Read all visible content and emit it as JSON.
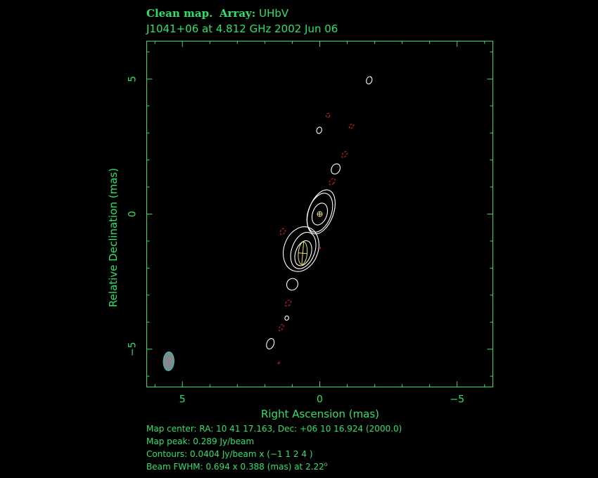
{
  "title": {
    "prefix": "Clean map.",
    "array_label": "Array:",
    "array_value": "UHbV",
    "subtitle": "J1041+06 at 4.812 GHz 2002 Jun 06"
  },
  "footer": {
    "map_center": "Map center:  RA: 10 41 17.163,  Dec: +06 10 16.924 (2000.0)",
    "map_peak": "Map peak: 0.289 Jy/beam",
    "contours": "Contours: 0.0404 Jy/beam x (−1 1 2 4 )",
    "beam_prefix": "Beam FWHM: 0.694 x 0.388 (mas) at 2.22",
    "beam_degree": "o"
  },
  "chart_data": {
    "type": "contour",
    "xlabel": "Right Ascension   (mas)",
    "ylabel": "Relative Declination   (mas)",
    "xlim": [
      6.3,
      -6.3
    ],
    "ylim": [
      -6.4,
      6.4
    ],
    "xticks": [
      5,
      0,
      -5
    ],
    "yticks": [
      5,
      0,
      -5
    ],
    "xtick_labels": [
      "5",
      "0",
      "−5"
    ],
    "ytick_labels": [
      "5",
      "0",
      "−5"
    ],
    "colors": {
      "axes": "#2ee06a",
      "positive_contour": "#ffffff",
      "negative_contour": "#d42020",
      "components": "#e8e060",
      "beam_fill": "#888888",
      "beam_edge": "#30c0c0"
    },
    "contours": [
      {
        "x": 0.0,
        "y": 0.0,
        "rx": 0.26,
        "ry": 0.42,
        "angle": 20,
        "sign": "positive",
        "level": 1
      },
      {
        "x": 0.0,
        "y": 0.05,
        "rx": 0.42,
        "ry": 0.75,
        "angle": 20,
        "sign": "positive",
        "level": 2
      },
      {
        "x": -0.05,
        "y": 0.08,
        "rx": 0.45,
        "ry": 0.85,
        "angle": 20,
        "sign": "positive",
        "level": 1
      },
      {
        "x": 0.6,
        "y": -1.45,
        "rx": 0.28,
        "ry": 0.48,
        "angle": 20,
        "sign": "positive",
        "level": 4
      },
      {
        "x": 0.6,
        "y": -1.35,
        "rx": 0.42,
        "ry": 0.7,
        "angle": 20,
        "sign": "positive",
        "level": 2
      },
      {
        "x": 0.68,
        "y": -1.3,
        "rx": 0.62,
        "ry": 0.85,
        "angle": 20,
        "sign": "positive",
        "level": 1
      },
      {
        "x": -1.8,
        "y": 4.95,
        "rx": 0.1,
        "ry": 0.14,
        "angle": 20,
        "sign": "positive",
        "level": 1
      },
      {
        "x": 0.02,
        "y": 3.1,
        "rx": 0.09,
        "ry": 0.12,
        "angle": 20,
        "sign": "positive",
        "level": 1
      },
      {
        "x": -0.58,
        "y": 1.67,
        "rx": 0.15,
        "ry": 0.2,
        "angle": 30,
        "sign": "positive",
        "level": 1
      },
      {
        "x": 1.0,
        "y": -2.6,
        "rx": 0.2,
        "ry": 0.22,
        "angle": 30,
        "sign": "positive",
        "level": 1
      },
      {
        "x": 1.2,
        "y": -3.85,
        "rx": 0.07,
        "ry": 0.08,
        "angle": 20,
        "sign": "positive",
        "level": 1
      },
      {
        "x": 1.8,
        "y": -4.8,
        "rx": 0.13,
        "ry": 0.2,
        "angle": 20,
        "sign": "positive",
        "level": 1
      },
      {
        "x": -0.3,
        "y": 3.65,
        "rx": 0.06,
        "ry": 0.08,
        "angle": 20,
        "sign": "negative",
        "level": -1
      },
      {
        "x": -1.15,
        "y": 3.25,
        "rx": 0.06,
        "ry": 0.1,
        "angle": 40,
        "sign": "negative",
        "level": -1
      },
      {
        "x": -0.9,
        "y": 2.2,
        "rx": 0.07,
        "ry": 0.13,
        "angle": 40,
        "sign": "negative",
        "level": -1
      },
      {
        "x": -0.45,
        "y": 1.2,
        "rx": 0.08,
        "ry": 0.14,
        "angle": 40,
        "sign": "negative",
        "level": -1
      },
      {
        "x": 1.35,
        "y": -0.65,
        "rx": 0.08,
        "ry": 0.12,
        "angle": 30,
        "sign": "negative",
        "level": -1
      },
      {
        "x": 0.0,
        "y": -1.25,
        "rx": 0.03,
        "ry": 0.03,
        "angle": 0,
        "sign": "negative",
        "level": -1
      },
      {
        "x": 1.15,
        "y": -3.3,
        "rx": 0.08,
        "ry": 0.13,
        "angle": 40,
        "sign": "negative",
        "level": -1
      },
      {
        "x": 1.4,
        "y": -4.2,
        "rx": 0.06,
        "ry": 0.14,
        "angle": 30,
        "sign": "negative",
        "level": -1
      },
      {
        "x": 1.5,
        "y": -5.5,
        "rx": 0.03,
        "ry": 0.03,
        "angle": 0,
        "sign": "negative",
        "level": -1
      }
    ],
    "components": [
      {
        "x": 0.0,
        "y": 0.0,
        "rx": 0.09,
        "ry": 0.09,
        "angle": 0
      },
      {
        "x": 0.62,
        "y": -1.45,
        "rx": 0.16,
        "ry": 0.42,
        "angle": 5
      }
    ],
    "beam": {
      "x": 5.5,
      "y": -5.45,
      "major": 0.694,
      "minor": 0.388,
      "pa": 2.22
    }
  }
}
